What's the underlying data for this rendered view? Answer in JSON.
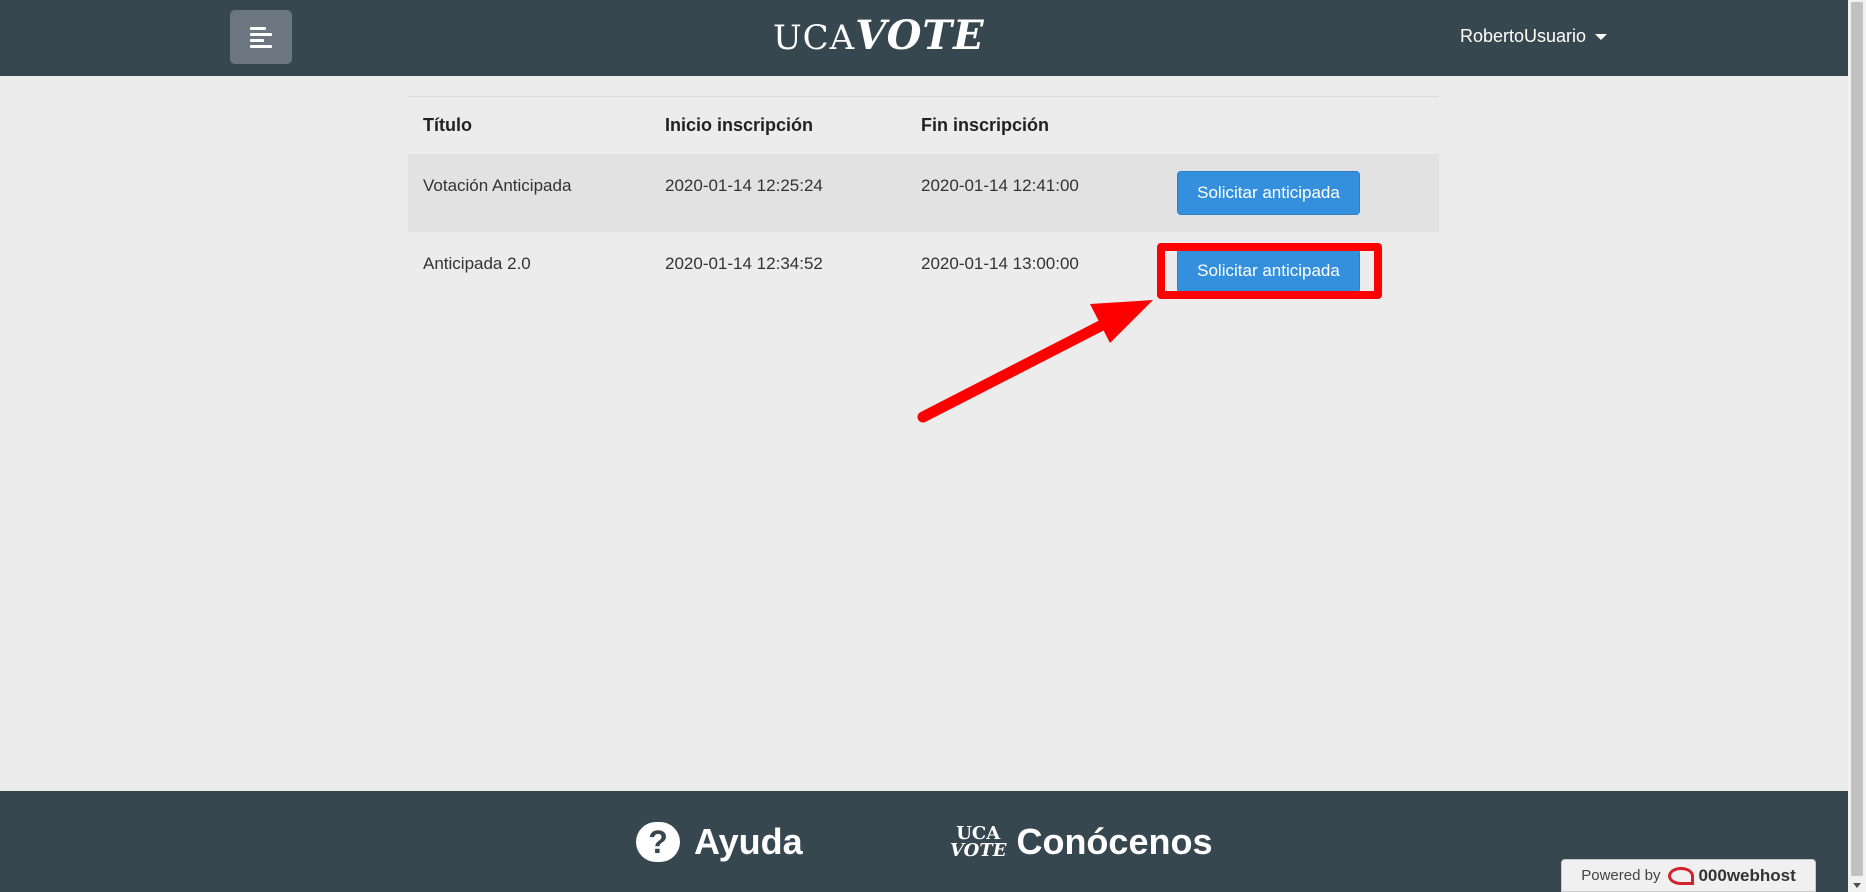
{
  "header": {
    "menu_icon": "menu-icon",
    "logo": {
      "part1": "UCA",
      "part2": "VOTE"
    },
    "user_name": "RobertoUsuario",
    "user_caret_icon": "caret-down-icon"
  },
  "table": {
    "headers": [
      "Título",
      "Inicio inscripción",
      "Fin inscripción",
      ""
    ],
    "rows": [
      {
        "titulo": "Votación Anticipada",
        "inicio": "2020-01-14 12:25:24",
        "fin": "2020-01-14 12:41:00",
        "action": "Solicitar anticipada"
      },
      {
        "titulo": "Anticipada 2.0",
        "inicio": "2020-01-14 12:34:52",
        "fin": "2020-01-14 13:00:00",
        "action": "Solicitar anticipada"
      }
    ]
  },
  "annotation": {
    "color": "#ff0000",
    "target": "rows.1.action"
  },
  "footer": {
    "help_icon": "question-mark-icon",
    "help_label": "Ayuda",
    "about_logo": {
      "line1": "UCA",
      "line2": "VOTE"
    },
    "about_label": "Conócenos"
  },
  "powered_by": {
    "prefix": "Powered by",
    "brand_icon": "000webhost-logo-icon",
    "brand": "000webhost"
  },
  "colors": {
    "navbar": "#37474f",
    "button": "#3490dc",
    "background": "#ececec"
  }
}
